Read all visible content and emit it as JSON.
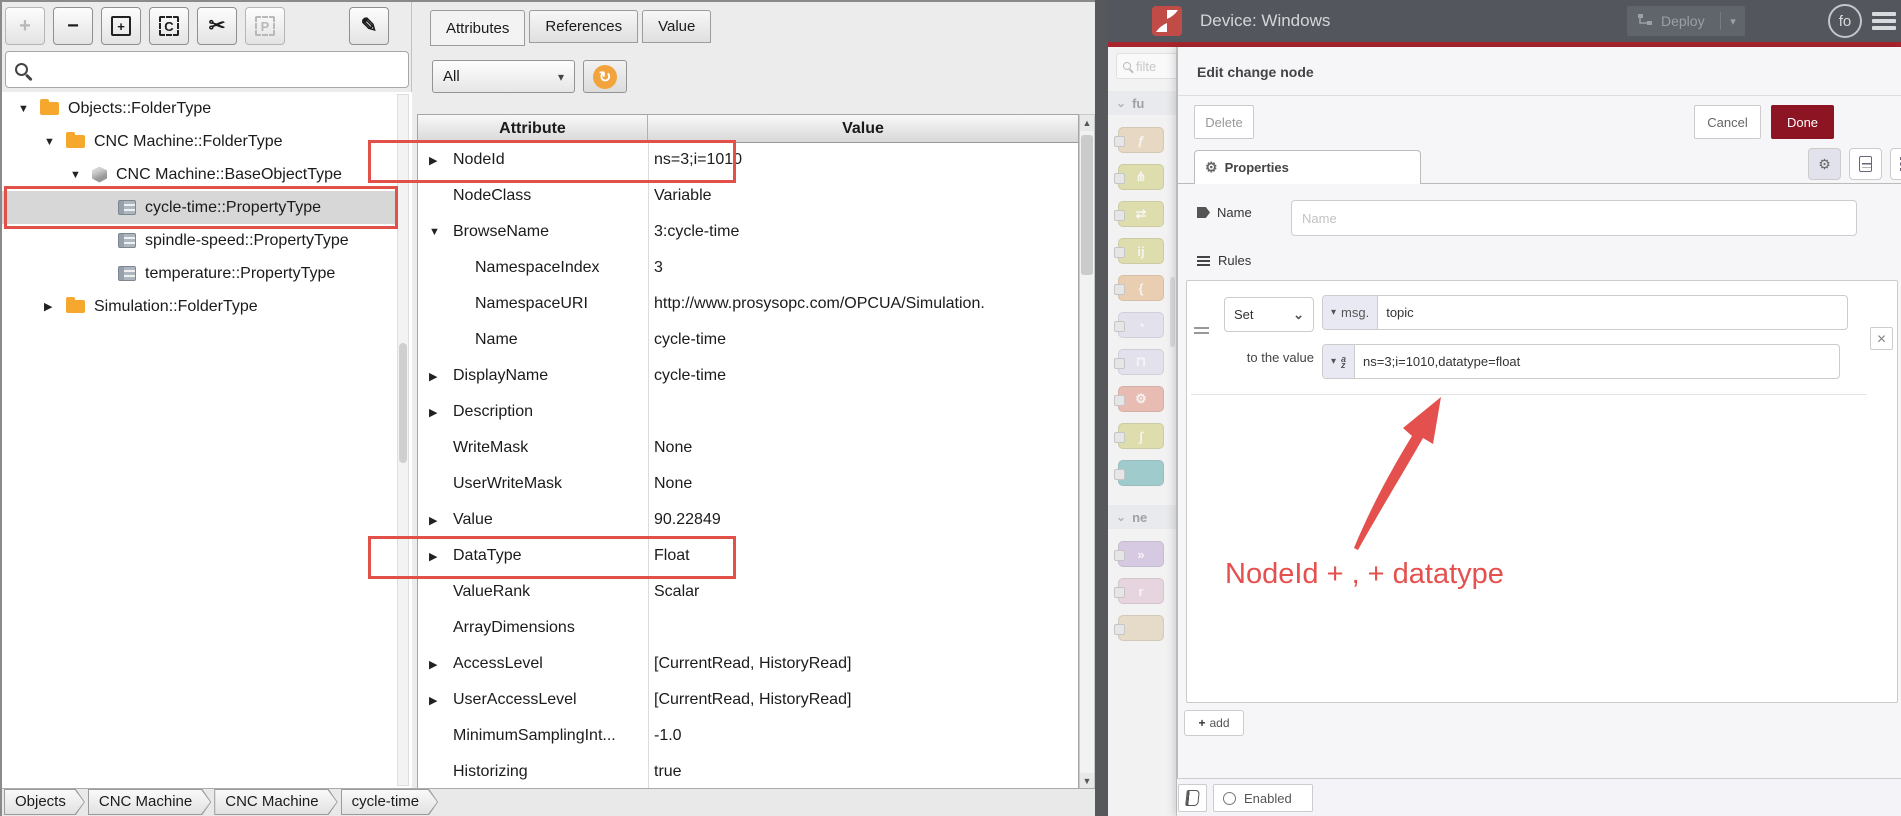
{
  "opcua": {
    "toolbar": [
      {
        "name": "add",
        "glyph": "+",
        "style": "plain",
        "disabled": true
      },
      {
        "name": "remove",
        "glyph": "−",
        "style": "plain"
      },
      {
        "name": "new-object",
        "glyph": "+",
        "style": "box"
      },
      {
        "name": "copy",
        "glyph": "C",
        "style": "dashed-box"
      },
      {
        "name": "cut",
        "glyph": "✂",
        "style": "plain"
      },
      {
        "name": "paste",
        "glyph": "P",
        "style": "dashed-box",
        "disabled": true
      },
      {
        "name": "edit",
        "glyph": "✎",
        "style": "plain"
      }
    ],
    "tabs": [
      {
        "label": "Attributes",
        "active": true
      },
      {
        "label": "References"
      },
      {
        "label": "Value"
      }
    ],
    "filter_value": "All",
    "tree": [
      {
        "label": "Objects::FolderType",
        "exp": "▼",
        "icon": "folder",
        "depth": 0
      },
      {
        "label": "CNC Machine::FolderType",
        "exp": "▼",
        "icon": "folder",
        "depth": 1
      },
      {
        "label": "CNC Machine::BaseObjectType",
        "exp": "▼",
        "icon": "cube",
        "depth": 2
      },
      {
        "label": "cycle-time::PropertyType",
        "exp": "",
        "icon": "list",
        "depth": 3,
        "selected": true,
        "highlight": true
      },
      {
        "label": "spindle-speed::PropertyType",
        "exp": "",
        "icon": "list",
        "depth": 3
      },
      {
        "label": "temperature::PropertyType",
        "exp": "",
        "icon": "list",
        "depth": 3
      },
      {
        "label": "Simulation::FolderType",
        "exp": "▶",
        "icon": "folder",
        "depth": 1
      }
    ],
    "table": {
      "col_attribute": "Attribute",
      "col_value": "Value",
      "rows": [
        {
          "attr": "NodeId",
          "value": "ns=3;i=1010",
          "exp": "▶",
          "highlight": true
        },
        {
          "attr": "NodeClass",
          "value": "Variable",
          "exp": ""
        },
        {
          "attr": "BrowseName",
          "value": "3:cycle-time",
          "exp": "▼"
        },
        {
          "attr": "NamespaceIndex",
          "value": "3",
          "exp": "",
          "indent": true
        },
        {
          "attr": "NamespaceURI",
          "value": "http://www.prosysopc.com/OPCUA/Simulation.",
          "exp": "",
          "indent": true
        },
        {
          "attr": "Name",
          "value": "cycle-time",
          "exp": "",
          "indent": true
        },
        {
          "attr": "DisplayName",
          "value": "cycle-time",
          "exp": "▶"
        },
        {
          "attr": "Description",
          "value": "",
          "exp": "▶"
        },
        {
          "attr": "WriteMask",
          "value": "None",
          "exp": ""
        },
        {
          "attr": "UserWriteMask",
          "value": "None",
          "exp": ""
        },
        {
          "attr": "Value",
          "value": "90.22849",
          "exp": "▶"
        },
        {
          "attr": "DataType",
          "value": "Float",
          "exp": "▶",
          "highlight": true
        },
        {
          "attr": "ValueRank",
          "value": "Scalar",
          "exp": ""
        },
        {
          "attr": "ArrayDimensions",
          "value": "",
          "exp": ""
        },
        {
          "attr": "AccessLevel",
          "value": "[CurrentRead, HistoryRead]",
          "exp": "▶"
        },
        {
          "attr": "UserAccessLevel",
          "value": "[CurrentRead, HistoryRead]",
          "exp": "▶"
        },
        {
          "attr": "MinimumSamplingInt...",
          "value": "-1.0",
          "exp": ""
        },
        {
          "attr": "Historizing",
          "value": "true",
          "exp": ""
        }
      ]
    },
    "breadcrumbs": [
      "Objects",
      "CNC Machine",
      "CNC Machine",
      "cycle-time"
    ]
  },
  "nodered": {
    "header": {
      "title": "Device: Windows",
      "deploy_label": "Deploy",
      "user_initials": "fo"
    },
    "palette": {
      "search_text": "filte",
      "category_function": "fu",
      "category_network": "ne",
      "function_nodes": [
        {
          "name": "function-node",
          "color": "#d9bd8e",
          "glyph": "ƒ"
        },
        {
          "name": "switch-node",
          "color": "#c9c766",
          "glyph": "⋔"
        },
        {
          "name": "change-node",
          "color": "#c9c766",
          "glyph": "⇄"
        },
        {
          "name": "range-node",
          "color": "#c9c766",
          "glyph": "ij"
        },
        {
          "name": "template-node",
          "color": "#e0a96e",
          "glyph": "{"
        },
        {
          "name": "delay-node",
          "color": "#d3cfe3",
          "glyph": "◔"
        },
        {
          "name": "trigger-node",
          "color": "#d3cfe3",
          "glyph": "⊓"
        },
        {
          "name": "exec-node",
          "color": "#dd8570",
          "glyph": "⚙"
        },
        {
          "name": "filter-node",
          "color": "#c9c766",
          "glyph": "∫"
        },
        {
          "name": "link-node",
          "color": "#4da3a3",
          "glyph": ""
        }
      ],
      "network_nodes": [
        {
          "name": "mqtt-node",
          "color": "#b9a1cf",
          "glyph": "»"
        },
        {
          "name": "request-node",
          "color": "#d9b7c6",
          "glyph": "r"
        },
        {
          "name": "websocket-node",
          "color": "#d9c29a",
          "glyph": ""
        }
      ]
    },
    "edit": {
      "title": "Edit change node",
      "delete_label": "Delete",
      "cancel_label": "Cancel",
      "done_label": "Done",
      "properties_tab": "Properties",
      "name_label": "Name",
      "name_placeholder": "Name",
      "rules_label": "Rules",
      "rule": {
        "action": "Set",
        "property_prefix": "msg.",
        "property": "topic",
        "to_label": "to the value",
        "value_type_a": "a",
        "value_type_z": "z",
        "value": "ns=3;i=1010,datatype=float"
      },
      "add_label": "add"
    },
    "footer": {
      "enabled_label": "Enabled"
    },
    "annotation": "NodeId + , + datatype"
  },
  "colors": {
    "annotation_red": "#e4504d",
    "highlight_red": "#e2504a",
    "done_red": "#8d1423",
    "header_gray": "#53565c",
    "brand_line_red": "#a8242e",
    "folder_orange": "#f5a72e",
    "refresh_orange": "#f2a33c",
    "link_teal": "#4da3a3"
  }
}
